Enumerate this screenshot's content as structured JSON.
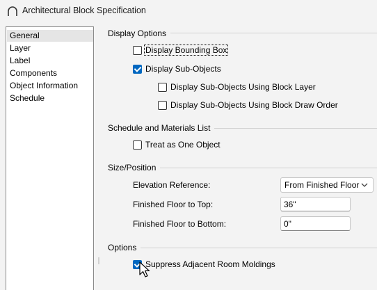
{
  "window": {
    "title": "Architectural Block Specification",
    "icon": "app-arc-icon"
  },
  "sidebar": {
    "items": [
      {
        "label": "General",
        "selected": true
      },
      {
        "label": "Layer",
        "selected": false
      },
      {
        "label": "Label",
        "selected": false
      },
      {
        "label": "Components",
        "selected": false
      },
      {
        "label": "Object Information",
        "selected": false
      },
      {
        "label": "Schedule",
        "selected": false
      }
    ]
  },
  "display_options": {
    "title": "Display Options",
    "bounding_box": {
      "label": "Display Bounding Box",
      "checked": false
    },
    "sub_objects": {
      "label": "Display Sub-Objects",
      "checked": true
    },
    "sub_objects_layer": {
      "label": "Display Sub-Objects Using Block Layer",
      "checked": false
    },
    "sub_objects_order": {
      "label": "Display Sub-Objects Using Block Draw Order",
      "checked": false
    }
  },
  "schedule": {
    "title": "Schedule and Materials List",
    "treat_as_one": {
      "label": "Treat as One Object",
      "checked": false
    }
  },
  "size_position": {
    "title": "Size/Position",
    "elevation_reference": {
      "label": "Elevation Reference:",
      "value": "From Finished Floor"
    },
    "floor_to_top": {
      "label": "Finished Floor to Top:",
      "value": "36\""
    },
    "floor_to_bottom": {
      "label": "Finished Floor to Bottom:",
      "value": "0\""
    }
  },
  "options": {
    "title": "Options",
    "suppress_moldings": {
      "label": "Suppress Adjacent Room Moldings",
      "checked": true
    }
  },
  "colors": {
    "accent": "#0067c0",
    "selected_item": "#e5e5e5",
    "background": "#f3f3f3"
  }
}
